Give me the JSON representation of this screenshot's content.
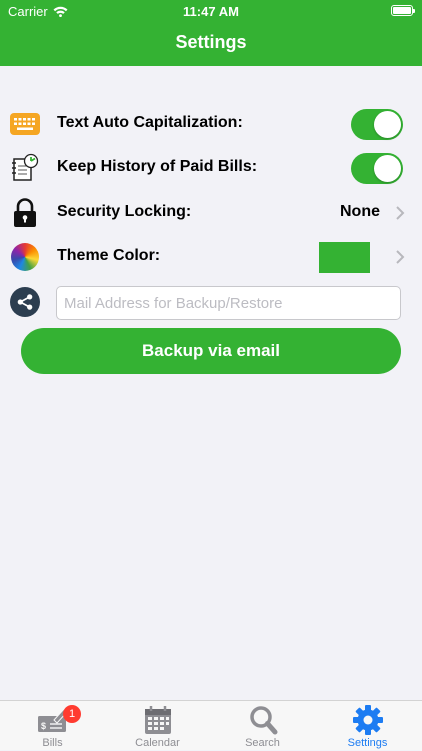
{
  "status_bar": {
    "carrier": "Carrier",
    "time": "11:47 AM"
  },
  "nav": {
    "title": "Settings"
  },
  "colors": {
    "accent": "#34b233",
    "tab_active": "#1d7cf2",
    "tab_inactive": "#8e8e93",
    "badge": "#ff3b30"
  },
  "settings": [
    {
      "label": "Text Auto Capitalization:",
      "icon": "keyboard-icon",
      "control": "toggle",
      "on": true
    },
    {
      "label": "Keep History of Paid Bills:",
      "icon": "history-notepad-icon",
      "control": "toggle",
      "on": true
    },
    {
      "label": "Security Locking:",
      "icon": "lock-icon",
      "control": "disclosure",
      "value": "None"
    },
    {
      "label": "Theme Color:",
      "icon": "color-wheel-icon",
      "control": "color",
      "value_color": "#34b233"
    }
  ],
  "backup": {
    "icon": "share-icon",
    "email_placeholder": "Mail Address for Backup/Restore",
    "email_value": "",
    "button_label": "Backup via email"
  },
  "tabbar": {
    "tabs": [
      {
        "label": "Bills",
        "icon": "bills-check-icon",
        "badge": "1",
        "active": false
      },
      {
        "label": "Calendar",
        "icon": "calendar-icon",
        "active": false
      },
      {
        "label": "Search",
        "icon": "search-icon",
        "active": false
      },
      {
        "label": "Settings",
        "icon": "gear-icon",
        "active": true
      }
    ]
  }
}
